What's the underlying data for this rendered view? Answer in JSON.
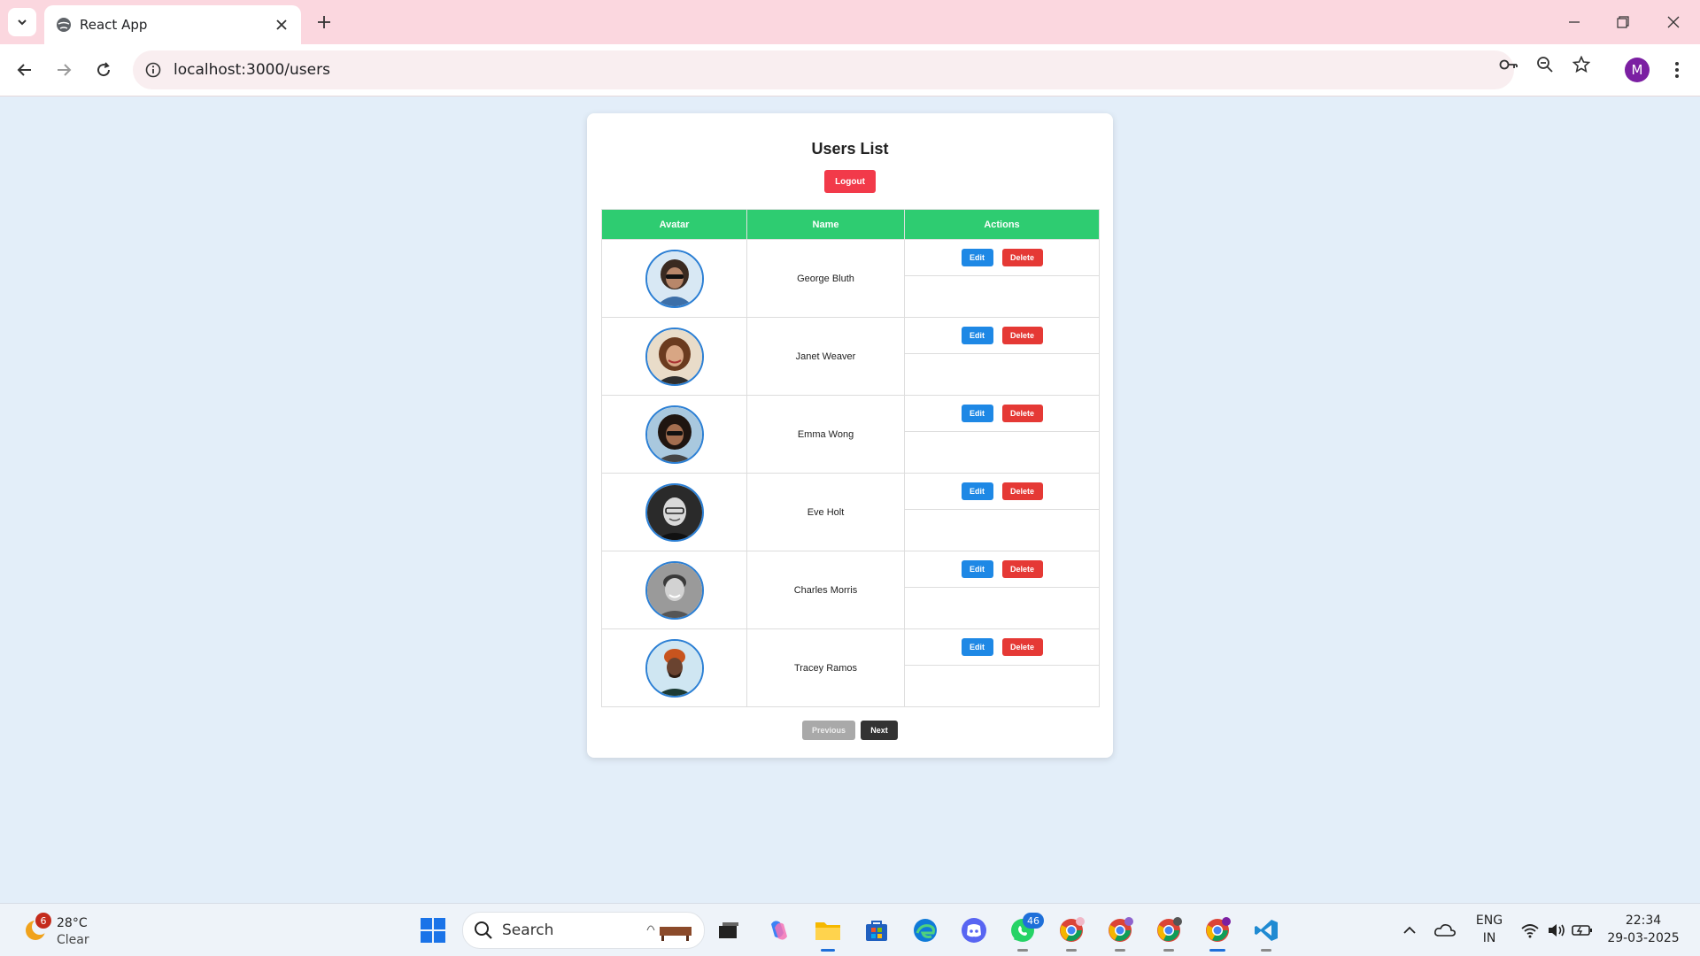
{
  "browser": {
    "tab_title": "React App",
    "url": "localhost:3000/users",
    "profile_initial": "M"
  },
  "page": {
    "title": "Users List",
    "logout_label": "Logout",
    "columns": [
      "Avatar",
      "Name",
      "Actions"
    ],
    "edit_label": "Edit",
    "delete_label": "Delete",
    "users": [
      {
        "name": "George Bluth",
        "avatar": "avatar-george"
      },
      {
        "name": "Janet Weaver",
        "avatar": "avatar-janet"
      },
      {
        "name": "Emma Wong",
        "avatar": "avatar-emma"
      },
      {
        "name": "Eve Holt",
        "avatar": "avatar-eve"
      },
      {
        "name": "Charles Morris",
        "avatar": "avatar-charles"
      },
      {
        "name": "Tracey Ramos",
        "avatar": "avatar-tracey"
      }
    ],
    "previous_label": "Previous",
    "next_label": "Next"
  },
  "taskbar": {
    "weather_temp": "28°C",
    "weather_condition": "Clear",
    "weather_badge": "6",
    "search_placeholder": "Search",
    "whatsapp_badge": "46",
    "language_line1": "ENG",
    "language_line2": "IN",
    "time": "22:34",
    "date": "29-03-2025"
  },
  "colors": {
    "header_green": "#2ecc71",
    "logout_red": "#f23a4a",
    "edit_blue": "#1e88e5",
    "delete_red": "#e53935",
    "page_bg": "#e3eef9",
    "tab_strip_pink": "#fbd7df"
  }
}
